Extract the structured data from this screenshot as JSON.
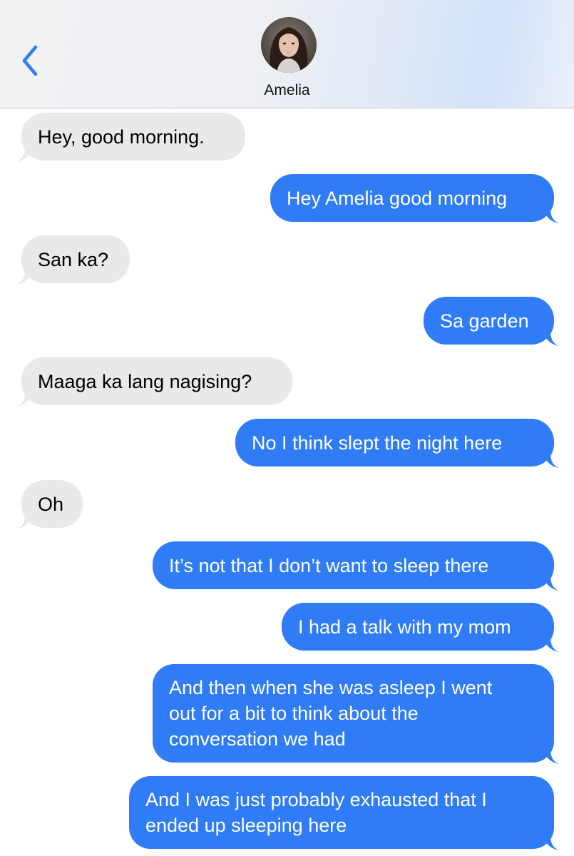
{
  "header": {
    "back_icon": "chevron-left-icon",
    "contact_name": "Amelia",
    "avatar_icon": "contact-photo"
  },
  "colors": {
    "incoming_bubble": "#e9e9eb",
    "outgoing_bubble": "#2f7cf6",
    "accent": "#2f7cf6"
  },
  "messages": [
    {
      "direction": "incoming",
      "text": "Hey, good morning."
    },
    {
      "direction": "outgoing",
      "text": "Hey Amelia good morning"
    },
    {
      "direction": "incoming",
      "text": "San ka?"
    },
    {
      "direction": "outgoing",
      "text": "Sa garden"
    },
    {
      "direction": "incoming",
      "text": "Maaga ka lang nagising?"
    },
    {
      "direction": "outgoing",
      "text": "No I think slept the night here"
    },
    {
      "direction": "incoming",
      "text": "Oh"
    },
    {
      "direction": "outgoing",
      "text": "It’s not that I don’t want to sleep there"
    },
    {
      "direction": "outgoing",
      "text": "I had a talk with my mom"
    },
    {
      "direction": "outgoing",
      "text": "And then when she was asleep I went\nout for a bit to think about the\nconversation we had"
    },
    {
      "direction": "outgoing",
      "text": "And I was just probably exhausted that I\nended up sleeping here"
    }
  ]
}
